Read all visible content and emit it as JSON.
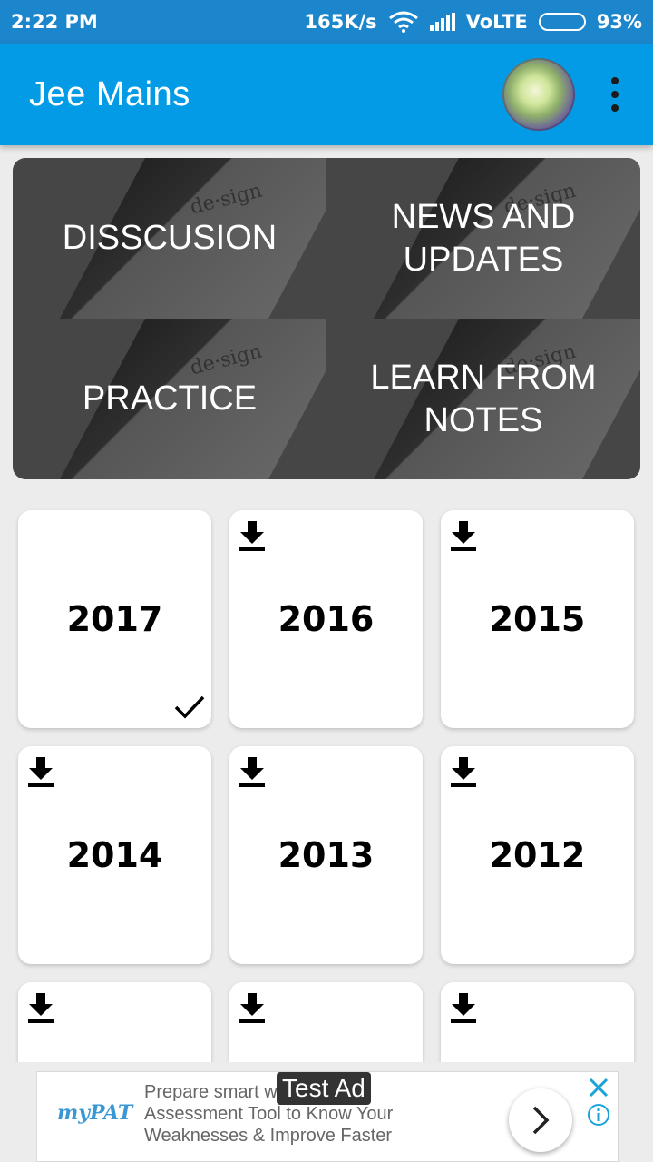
{
  "status": {
    "time": "2:22 PM",
    "speed": "165K/s",
    "network": "VoLTE",
    "battery": "93%",
    "battery_level": 0.93
  },
  "app_bar": {
    "title": "Jee Mains"
  },
  "menu": {
    "items": [
      {
        "label": "DISSCUSION"
      },
      {
        "label": "NEWS AND UPDATES"
      },
      {
        "label": "PRACTICE"
      },
      {
        "label": "LEARN FROM NOTES"
      }
    ],
    "decor_text": "de·sign"
  },
  "papers": {
    "items": [
      {
        "year": "2017",
        "downloaded": true
      },
      {
        "year": "2016",
        "downloaded": false
      },
      {
        "year": "2015",
        "downloaded": false
      },
      {
        "year": "2014",
        "downloaded": false
      },
      {
        "year": "2013",
        "downloaded": false
      },
      {
        "year": "2012",
        "downloaded": false
      },
      {
        "year": "",
        "downloaded": false
      },
      {
        "year": "",
        "downloaded": false
      },
      {
        "year": "",
        "downloaded": false
      }
    ]
  },
  "ad": {
    "logo": "myPAT",
    "text": "Prepare smart with Online Assessment Tool to Know Your Weaknesses & Improve Faster",
    "badge": "Test Ad"
  },
  "colors": {
    "status_bar": "#1c86cc",
    "app_bar": "#039be5",
    "tile_bg": "#464646"
  }
}
